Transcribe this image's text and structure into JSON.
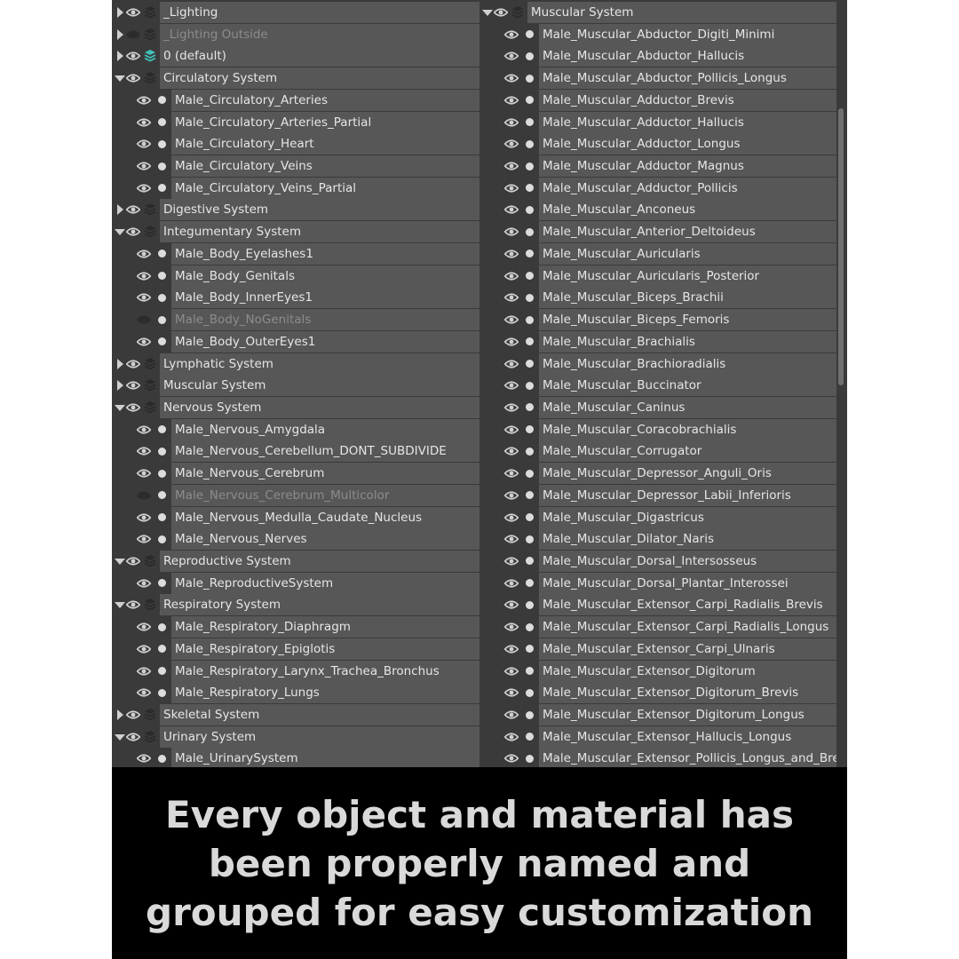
{
  "left_tree": [
    {
      "kind": "group",
      "label": "_Lighting",
      "expand": "collapsed",
      "visible": true
    },
    {
      "kind": "group",
      "label": "_Lighting Outside",
      "expand": "collapsed",
      "visible": false,
      "dim": true
    },
    {
      "kind": "group",
      "label": "0 (default)",
      "expand": "collapsed",
      "visible": true,
      "active": true
    },
    {
      "kind": "group",
      "label": "Circulatory System",
      "expand": "expanded",
      "visible": true
    },
    {
      "kind": "item",
      "label": "Male_Circulatory_Arteries",
      "visible": true
    },
    {
      "kind": "item",
      "label": "Male_Circulatory_Arteries_Partial",
      "visible": true
    },
    {
      "kind": "item",
      "label": "Male_Circulatory_Heart",
      "visible": true
    },
    {
      "kind": "item",
      "label": "Male_Circulatory_Veins",
      "visible": true
    },
    {
      "kind": "item",
      "label": "Male_Circulatory_Veins_Partial",
      "visible": true
    },
    {
      "kind": "group",
      "label": "Digestive System",
      "expand": "collapsed",
      "visible": true
    },
    {
      "kind": "group",
      "label": "Integumentary System",
      "expand": "expanded",
      "visible": true
    },
    {
      "kind": "item",
      "label": "Male_Body_Eyelashes1",
      "visible": true
    },
    {
      "kind": "item",
      "label": "Male_Body_Genitals",
      "visible": true
    },
    {
      "kind": "item",
      "label": "Male_Body_InnerEyes1",
      "visible": true
    },
    {
      "kind": "item",
      "label": "Male_Body_NoGenitals",
      "visible": false,
      "dim": true
    },
    {
      "kind": "item",
      "label": "Male_Body_OuterEyes1",
      "visible": true
    },
    {
      "kind": "group",
      "label": "Lymphatic System",
      "expand": "collapsed",
      "visible": true
    },
    {
      "kind": "group",
      "label": "Muscular System",
      "expand": "collapsed",
      "visible": true
    },
    {
      "kind": "group",
      "label": "Nervous System",
      "expand": "expanded",
      "visible": true
    },
    {
      "kind": "item",
      "label": "Male_Nervous_Amygdala",
      "visible": true
    },
    {
      "kind": "item",
      "label": "Male_Nervous_Cerebellum_DONT_SUBDIVIDE",
      "visible": true
    },
    {
      "kind": "item",
      "label": "Male_Nervous_Cerebrum",
      "visible": true
    },
    {
      "kind": "item",
      "label": "Male_Nervous_Cerebrum_Multicolor",
      "visible": false,
      "dim": true
    },
    {
      "kind": "item",
      "label": "Male_Nervous_Medulla_Caudate_Nucleus",
      "visible": true
    },
    {
      "kind": "item",
      "label": "Male_Nervous_Nerves",
      "visible": true
    },
    {
      "kind": "group",
      "label": "Reproductive System",
      "expand": "expanded",
      "visible": true
    },
    {
      "kind": "item",
      "label": "Male_ReproductiveSystem",
      "visible": true
    },
    {
      "kind": "group",
      "label": "Respiratory System",
      "expand": "expanded",
      "visible": true
    },
    {
      "kind": "item",
      "label": "Male_Respiratory_Diaphragm",
      "visible": true
    },
    {
      "kind": "item",
      "label": "Male_Respiratory_Epiglotis",
      "visible": true
    },
    {
      "kind": "item",
      "label": "Male_Respiratory_Larynx_Trachea_Bronchus",
      "visible": true
    },
    {
      "kind": "item",
      "label": "Male_Respiratory_Lungs",
      "visible": true
    },
    {
      "kind": "group",
      "label": "Skeletal System",
      "expand": "collapsed",
      "visible": true
    },
    {
      "kind": "group",
      "label": "Urinary System",
      "expand": "expanded",
      "visible": true
    },
    {
      "kind": "item",
      "label": "Male_UrinarySystem",
      "visible": true
    }
  ],
  "right_tree": [
    {
      "kind": "group",
      "label": "Muscular System",
      "expand": "expanded",
      "visible": true
    },
    {
      "kind": "item",
      "label": "Male_Muscular_Abductor_Digiti_Minimi",
      "visible": true
    },
    {
      "kind": "item",
      "label": "Male_Muscular_Abductor_Hallucis",
      "visible": true
    },
    {
      "kind": "item",
      "label": "Male_Muscular_Abductor_Pollicis_Longus",
      "visible": true
    },
    {
      "kind": "item",
      "label": "Male_Muscular_Adductor_Brevis",
      "visible": true
    },
    {
      "kind": "item",
      "label": "Male_Muscular_Adductor_Hallucis",
      "visible": true
    },
    {
      "kind": "item",
      "label": "Male_Muscular_Adductor_Longus",
      "visible": true
    },
    {
      "kind": "item",
      "label": "Male_Muscular_Adductor_Magnus",
      "visible": true
    },
    {
      "kind": "item",
      "label": "Male_Muscular_Adductor_Pollicis",
      "visible": true
    },
    {
      "kind": "item",
      "label": "Male_Muscular_Anconeus",
      "visible": true
    },
    {
      "kind": "item",
      "label": "Male_Muscular_Anterior_Deltoideus",
      "visible": true
    },
    {
      "kind": "item",
      "label": "Male_Muscular_Auricularis",
      "visible": true
    },
    {
      "kind": "item",
      "label": "Male_Muscular_Auricularis_Posterior",
      "visible": true
    },
    {
      "kind": "item",
      "label": "Male_Muscular_Biceps_Brachii",
      "visible": true
    },
    {
      "kind": "item",
      "label": "Male_Muscular_Biceps_Femoris",
      "visible": true
    },
    {
      "kind": "item",
      "label": "Male_Muscular_Brachialis",
      "visible": true
    },
    {
      "kind": "item",
      "label": "Male_Muscular_Brachioradialis",
      "visible": true
    },
    {
      "kind": "item",
      "label": "Male_Muscular_Buccinator",
      "visible": true
    },
    {
      "kind": "item",
      "label": "Male_Muscular_Caninus",
      "visible": true
    },
    {
      "kind": "item",
      "label": "Male_Muscular_Coracobrachialis",
      "visible": true
    },
    {
      "kind": "item",
      "label": "Male_Muscular_Corrugator",
      "visible": true
    },
    {
      "kind": "item",
      "label": "Male_Muscular_Depressor_Anguli_Oris",
      "visible": true
    },
    {
      "kind": "item",
      "label": "Male_Muscular_Depressor_Labii_Inferioris",
      "visible": true
    },
    {
      "kind": "item",
      "label": "Male_Muscular_Digastricus",
      "visible": true
    },
    {
      "kind": "item",
      "label": "Male_Muscular_Dilator_Naris",
      "visible": true
    },
    {
      "kind": "item",
      "label": "Male_Muscular_Dorsal_Intersosseus",
      "visible": true
    },
    {
      "kind": "item",
      "label": "Male_Muscular_Dorsal_Plantar_Interossei",
      "visible": true
    },
    {
      "kind": "item",
      "label": "Male_Muscular_Extensor_Carpi_Radialis_Brevis",
      "visible": true
    },
    {
      "kind": "item",
      "label": "Male_Muscular_Extensor_Carpi_Radialis_Longus",
      "visible": true
    },
    {
      "kind": "item",
      "label": "Male_Muscular_Extensor_Carpi_Ulnaris",
      "visible": true
    },
    {
      "kind": "item",
      "label": "Male_Muscular_Extensor_Digitorum",
      "visible": true
    },
    {
      "kind": "item",
      "label": "Male_Muscular_Extensor_Digitorum_Brevis",
      "visible": true
    },
    {
      "kind": "item",
      "label": "Male_Muscular_Extensor_Digitorum_Longus",
      "visible": true
    },
    {
      "kind": "item",
      "label": "Male_Muscular_Extensor_Hallucis_Longus",
      "visible": true
    },
    {
      "kind": "item",
      "label": "Male_Muscular_Extensor_Pollicis_Longus_and_Brevis",
      "visible": true
    }
  ],
  "colors": {
    "panel_bg": "#3a3a3a",
    "row_bg": "#575757",
    "text": "#e6e6e6",
    "dim_text": "#8c8c8c",
    "icon": "#d0d0d0",
    "icon_hidden": "#2c2c2c",
    "active_layer": "#3fc1b8",
    "caption_bg": "#000000",
    "caption_text": "#d9d9d9"
  },
  "caption": "Every object and material has been properly named and grouped for easy customization"
}
